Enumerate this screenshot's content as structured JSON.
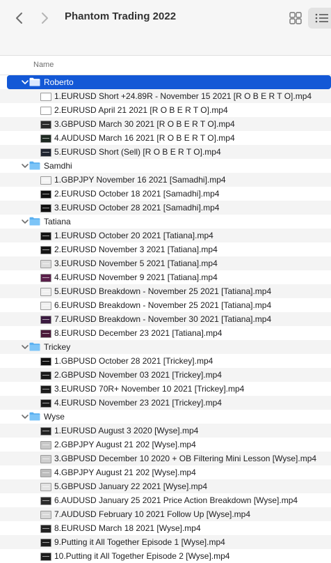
{
  "window": {
    "title": "Phantom Trading 2022"
  },
  "columns": {
    "name": "Name"
  },
  "rows": [
    {
      "type": "folder",
      "label": "Roberto",
      "selected": true
    },
    {
      "type": "file",
      "label": "1.EURUSD Short +24.89R - November 15 2021 [R O B E R T O].mp4",
      "thumb": "#ffffff"
    },
    {
      "type": "file",
      "label": "2.EURUSD April 21 2021 [R O B E R T O].mp4",
      "thumb": "#ffffff"
    },
    {
      "type": "file",
      "label": "3.GBPUSD March 30 2021 [R O B E R T O].mp4",
      "thumb": "#2a2a2a"
    },
    {
      "type": "file",
      "label": "4.AUDUSD March 16 2021 [R O B E R T O].mp4",
      "thumb": "#1e2a22"
    },
    {
      "type": "file",
      "label": "5.EURUSD Short (Sell) [R O B E R T O].mp4",
      "thumb": "#1f2430"
    },
    {
      "type": "folder",
      "label": "Samdhi"
    },
    {
      "type": "file",
      "label": "1.GBPJPY November 16 2021 [Samadhi].mp4",
      "thumb": "#f4f4f4"
    },
    {
      "type": "file",
      "label": "2.EURUSD October 18 2021 [Samadhi].mp4",
      "thumb": "#111111"
    },
    {
      "type": "file",
      "label": "3.EURUSD October 28 2021 [Samadhi].mp4",
      "thumb": "#111111"
    },
    {
      "type": "folder",
      "label": "Tatiana"
    },
    {
      "type": "file",
      "label": "1.EURUSD October 20 2021 [Tatiana].mp4",
      "thumb": "#141414"
    },
    {
      "type": "file",
      "label": "2.EURUSD November 3 2021 [Tatiana].mp4",
      "thumb": "#141414"
    },
    {
      "type": "file",
      "label": "3.EURUSD November 5 2021 [Tatiana].mp4",
      "thumb": "#dcdcdc"
    },
    {
      "type": "file",
      "label": "4.EURUSD November 9 2021 [Tatiana].mp4",
      "thumb": "#5a1f4a"
    },
    {
      "type": "file",
      "label": "5.EURUSD Breakdown - November 25 2021 [Tatiana].mp4",
      "thumb": "#f0f0f0"
    },
    {
      "type": "file",
      "label": "6.EURUSD Breakdown - November 25 2021 [Tatiana].mp4",
      "thumb": "#f0f0f0"
    },
    {
      "type": "file",
      "label": "7.EURUSD Breakdown - November 30 2021 [Tatiana].mp4",
      "thumb": "#3a1a40"
    },
    {
      "type": "file",
      "label": "8.EURUSD December 23 2021 [Tatiana].mp4",
      "thumb": "#4a1a3a"
    },
    {
      "type": "folder",
      "label": "Trickey"
    },
    {
      "type": "file",
      "label": "1.GBPUSD October 28 2021 [Trickey].mp4",
      "thumb": "#111111"
    },
    {
      "type": "file",
      "label": "2.GBPUSD November 03 2021 [Trickey].mp4",
      "thumb": "#1a1a1a"
    },
    {
      "type": "file",
      "label": "3.EURUSD 70R+ November 10 2021 [Trickey].mp4",
      "thumb": "#1a1a1a"
    },
    {
      "type": "file",
      "label": "4.EURUSD November 23 2021 [Trickey].mp4",
      "thumb": "#1a1a1a"
    },
    {
      "type": "folder",
      "label": "Wyse"
    },
    {
      "type": "file",
      "label": "1.EURUSD August 3 2020 [Wyse].mp4",
      "thumb": "#222222"
    },
    {
      "type": "file",
      "label": "2.GBPJPY August 21 202 [Wyse].mp4",
      "thumb": "#c8c8c8"
    },
    {
      "type": "file",
      "label": "3.GBPUSD December 10 2020 + OB Filtering Mini Lesson [Wyse].mp4",
      "thumb": "#cfcfcf"
    },
    {
      "type": "file",
      "label": "4.GBPJPY August 21 202 [Wyse].mp4",
      "thumb": "#bdbdbd"
    },
    {
      "type": "file",
      "label": "5.GBPUSD January 22 2021 [Wyse].mp4",
      "thumb": "#e2e2e2"
    },
    {
      "type": "file",
      "label": "6.AUDUSD January 25 2021 Price Action Breakdown [Wyse].mp4",
      "thumb": "#2a2a2a"
    },
    {
      "type": "file",
      "label": "7.AUDUSD February 10 2021 Follow Up [Wyse].mp4",
      "thumb": "#d8d8d8"
    },
    {
      "type": "file",
      "label": "8.EURUSD March 18 2021 [Wyse].mp4",
      "thumb": "#222222"
    },
    {
      "type": "file",
      "label": "9.Putting it All Together Episode 1 [Wyse].mp4",
      "thumb": "#1c1c1c"
    },
    {
      "type": "file",
      "label": "10.Putting it All Together Episode 2 [Wyse].mp4",
      "thumb": "#1c1c1c"
    }
  ],
  "colors": {
    "selection": "#1358d6",
    "folder": "#5ab0f0"
  }
}
